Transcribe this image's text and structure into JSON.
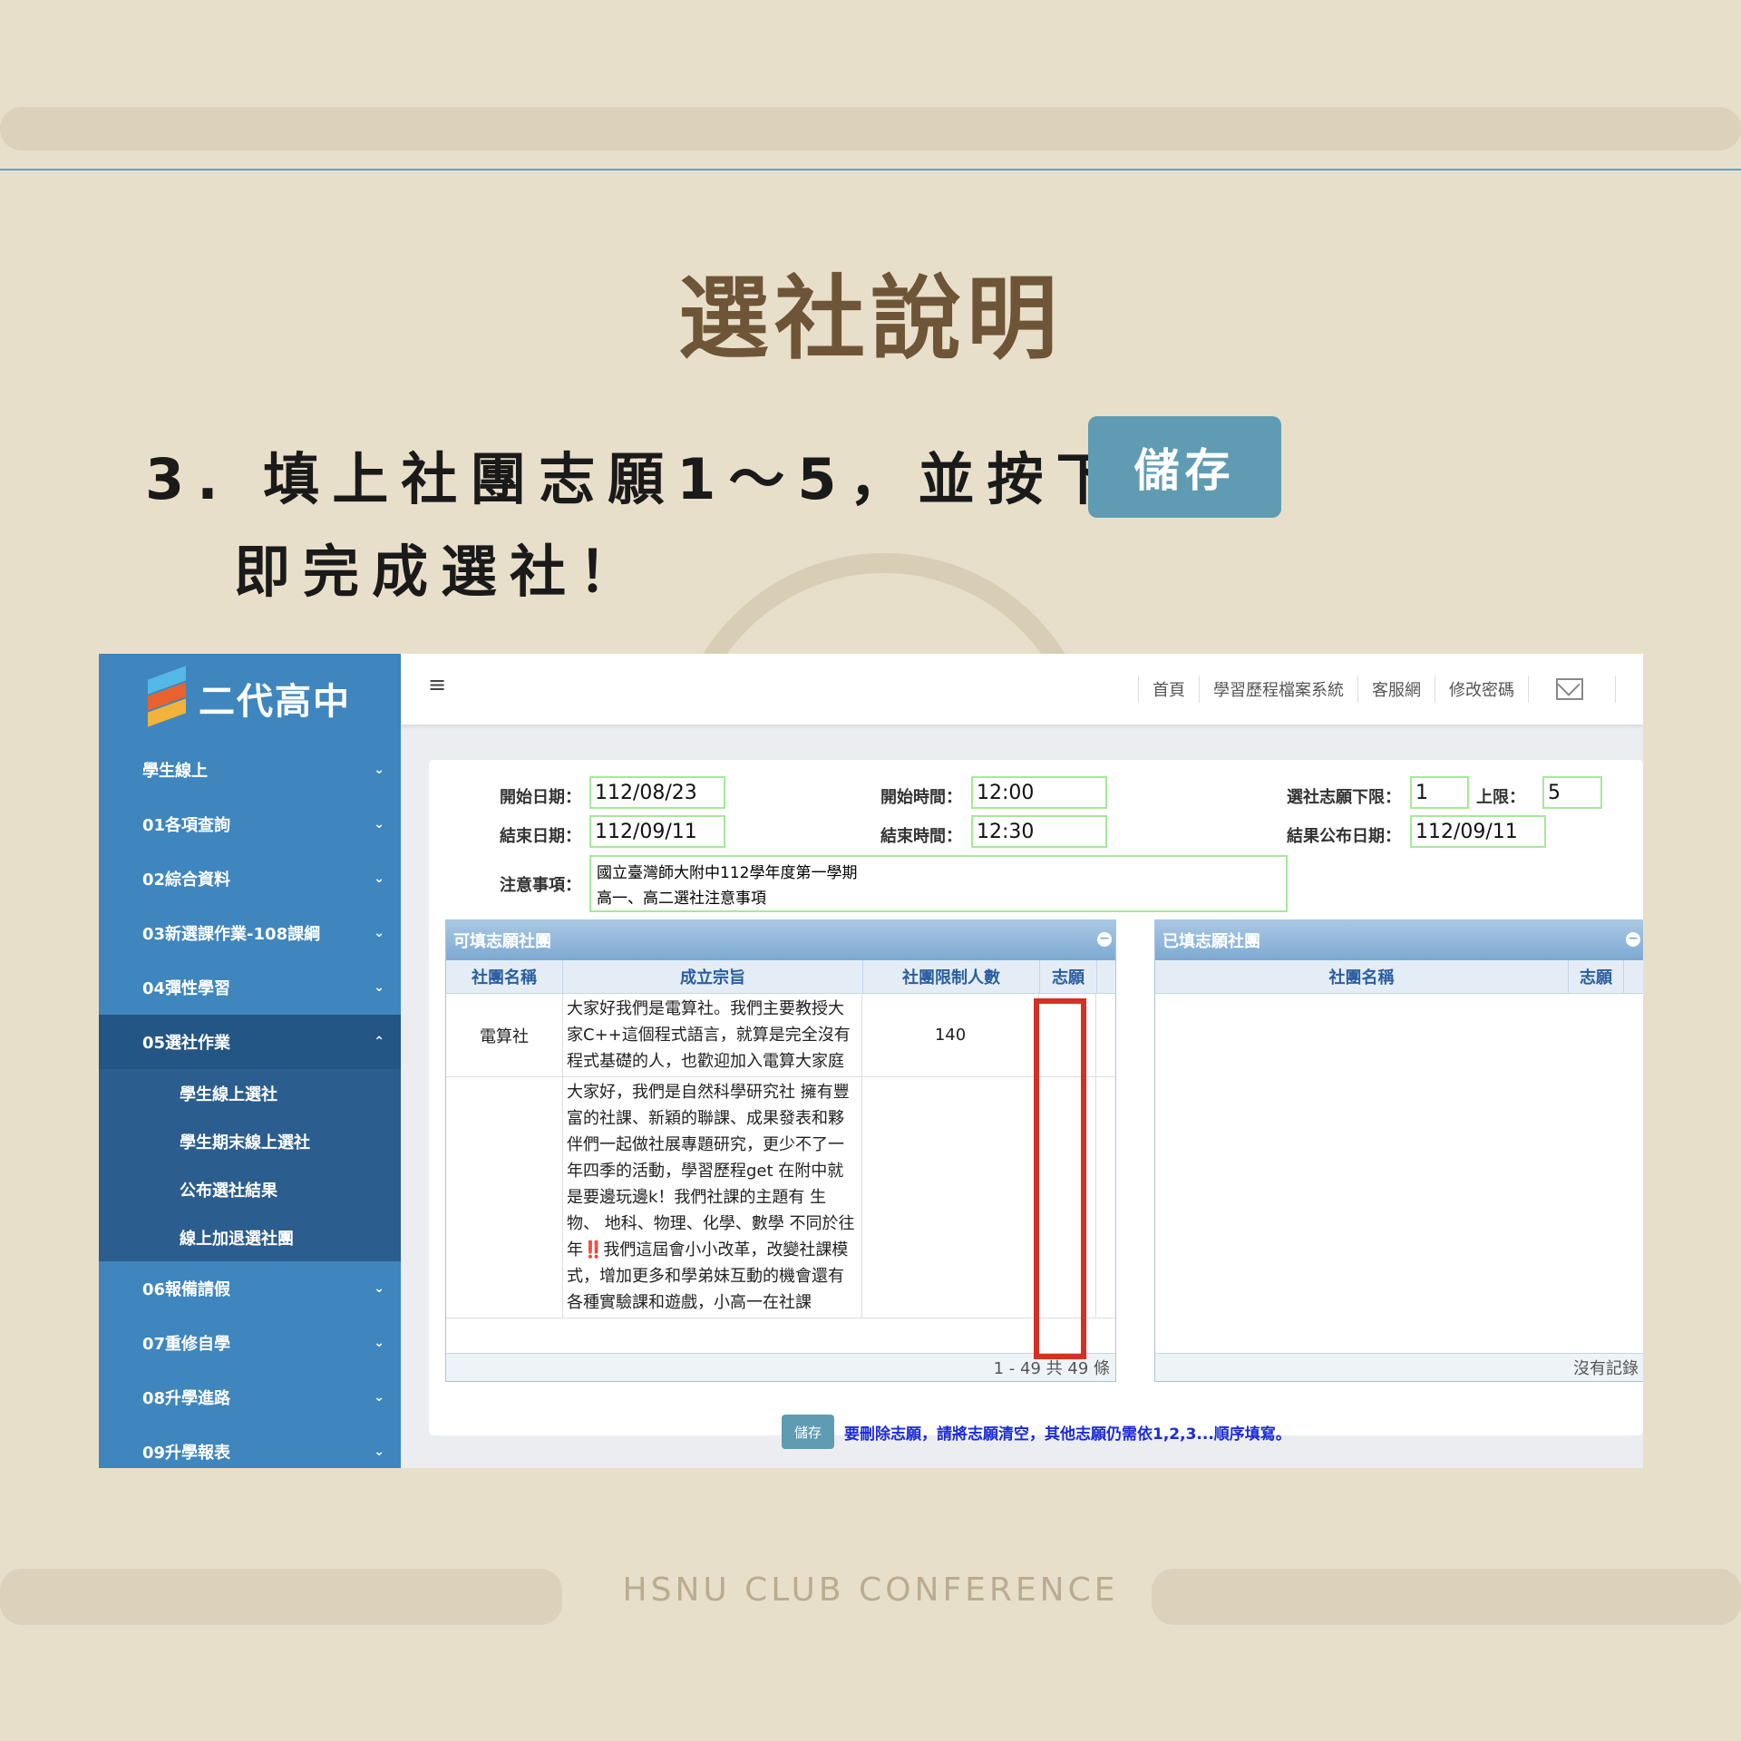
{
  "slide": {
    "title": "選社說明",
    "step_line1": "3. 填上社團志願1～5，並按下",
    "step_line2": "即完成選社！",
    "save_button": "儲存",
    "footer": "HSNU CLUB CONFERENCE"
  },
  "app": {
    "logo": "二代高中",
    "sidebar": {
      "items": [
        {
          "label": "學生線上"
        },
        {
          "label": "01各項查詢"
        },
        {
          "label": "02綜合資料"
        },
        {
          "label": "03新選課作業-108課綱"
        },
        {
          "label": "04彈性學習"
        },
        {
          "label": "05選社作業"
        },
        {
          "label": "06報備請假"
        },
        {
          "label": "07重修自學"
        },
        {
          "label": "08升學進路"
        },
        {
          "label": "09升學報表"
        }
      ],
      "subitems": [
        {
          "label": "學生線上選社"
        },
        {
          "label": "學生期末線上選社"
        },
        {
          "label": "公布選社結果"
        },
        {
          "label": "線上加退選社團"
        }
      ]
    },
    "topbar": {
      "menu_icon": "≡",
      "links": [
        "首頁",
        "學習歷程檔案系統",
        "客服網",
        "修改密碼"
      ]
    },
    "form": {
      "start_date_label": "開始日期：",
      "start_date": "112/08/23",
      "end_date_label": "結束日期：",
      "end_date": "112/09/11",
      "start_time_label": "開始時間：",
      "start_time": "12:00",
      "end_time_label": "結束時間：",
      "end_time": "12:30",
      "min_label": "選社志願下限：",
      "min": "1",
      "max_label": "上限：",
      "max": "5",
      "result_label": "結果公布日期：",
      "result_date": "112/09/11",
      "notes_label": "注意事項：",
      "notes_line1": "國立臺灣師大附中112學年度第一學期",
      "notes_line2": "高一、高二選社注意事項"
    },
    "left_grid": {
      "title": "可填志願社團",
      "headers": [
        "社團名稱",
        "成立宗旨",
        "社團限制人數",
        "志願"
      ],
      "rows": [
        {
          "name": "電算社",
          "desc": "大家好我們是電算社。我們主要教授大家C++這個程式語言，就算是完全沒有程式基礎的人，也歡迎加入電算大家庭",
          "limit": "140"
        },
        {
          "name": "",
          "desc": "大家好，我們是自然科學研究社 擁有豐富的社課、新穎的聯課、成果發表和夥伴們一起做社展專題研究，更少不了一年四季的活動，學習歷程get 在附中就是要邊玩邊k！我們社課的主題有 生物、 地科、物理、化學、數學 不同於往年‼️我們這屆會小小改革，改變社課模式，增加更多和學弟妹互動的機會還有各種實驗課和遊戲，小高一在社課",
          "limit": ""
        }
      ],
      "footer": "1 - 49 共 49 條"
    },
    "right_grid": {
      "title": "已填志願社團",
      "headers": [
        "社團名稱",
        "志願"
      ],
      "footer": "沒有記錄"
    },
    "bottom": {
      "save": "儲存",
      "note": "要刪除志願，請將志願清空，其他志願仍需依1,2,3...順序填寫。"
    }
  }
}
